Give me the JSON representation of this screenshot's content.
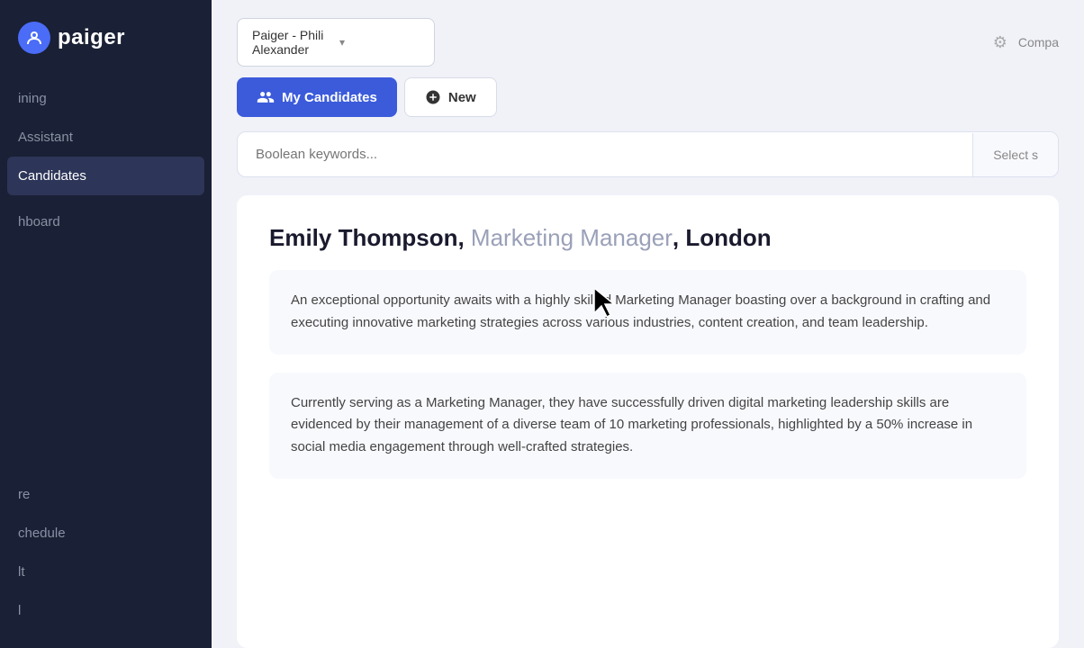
{
  "sidebar": {
    "logo": {
      "icon": "P",
      "text": "paiger"
    },
    "nav_items": [
      {
        "label": "Training",
        "active": false,
        "partial": "ining"
      },
      {
        "label": "Assistant",
        "active": false,
        "partial": "Assistant"
      },
      {
        "label": "Candidates",
        "active": true,
        "partial": "Candidates"
      },
      {
        "label": "Dashboard",
        "active": false,
        "partial": "hboard"
      },
      {
        "label": "Hire",
        "active": false,
        "partial": "re"
      },
      {
        "label": "Schedule",
        "active": false,
        "partial": "chedule"
      },
      {
        "label": "ult",
        "active": false,
        "partial": "lt"
      },
      {
        "label": "l",
        "active": false,
        "partial": "l"
      }
    ]
  },
  "topbar": {
    "workspace": {
      "label": "Paiger - Phili Alexander"
    },
    "company_text": "Compa"
  },
  "tabs": [
    {
      "label": "My Candidates",
      "active": true,
      "icon": "group"
    },
    {
      "label": "New",
      "active": false,
      "icon": "add_circle"
    }
  ],
  "search": {
    "placeholder": "Boolean keywords...",
    "select_label": "Select s"
  },
  "candidate": {
    "name": "Emily Thompson",
    "job_title": "Marketing Manager",
    "location": "London",
    "description_1": "An exceptional opportunity awaits with a highly skilled Marketing Manager boasting over a background in crafting and executing innovative marketing strategies across various industries, content creation, and team leadership.",
    "description_2": "Currently serving as a Marketing Manager, they have successfully driven digital marketing leadership skills are evidenced by their management of a diverse team of 10 marketing professionals, highlighted by a 50% increase in social media engagement through well-crafted strategies."
  }
}
